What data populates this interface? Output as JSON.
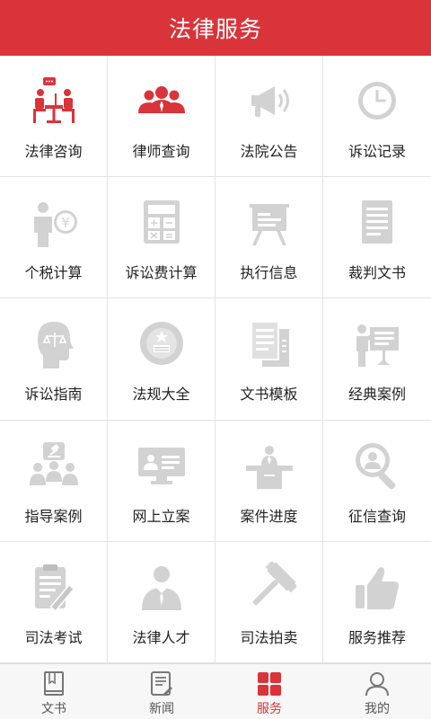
{
  "header": {
    "title": "法律服务"
  },
  "colors": {
    "accent": "#d9343a",
    "icon_gray": "#d2d2d2"
  },
  "services": [
    {
      "label": "法律咨询",
      "icon": "consult-icon",
      "active": true
    },
    {
      "label": "律师查询",
      "icon": "lawyers-icon",
      "active": true
    },
    {
      "label": "法院公告",
      "icon": "megaphone-icon",
      "active": false
    },
    {
      "label": "诉讼记录",
      "icon": "clock-icon",
      "active": false
    },
    {
      "label": "个税计算",
      "icon": "tax-icon",
      "active": false
    },
    {
      "label": "诉讼费计算",
      "icon": "calculator-icon",
      "active": false
    },
    {
      "label": "执行信息",
      "icon": "board-icon",
      "active": false
    },
    {
      "label": "裁判文书",
      "icon": "document-icon",
      "active": false
    },
    {
      "label": "诉讼指南",
      "icon": "scale-head-icon",
      "active": false
    },
    {
      "label": "法规大全",
      "icon": "emblem-icon",
      "active": false
    },
    {
      "label": "文书模板",
      "icon": "template-icon",
      "active": false
    },
    {
      "label": "经典案例",
      "icon": "presentation-icon",
      "active": false
    },
    {
      "label": "指导案例",
      "icon": "gavel-group-icon",
      "active": false
    },
    {
      "label": "网上立案",
      "icon": "id-card-icon",
      "active": false
    },
    {
      "label": "案件进度",
      "icon": "podium-icon",
      "active": false
    },
    {
      "label": "征信查询",
      "icon": "magnifier-person-icon",
      "active": false
    },
    {
      "label": "司法考试",
      "icon": "clipboard-pen-icon",
      "active": false
    },
    {
      "label": "法律人才",
      "icon": "person-suit-icon",
      "active": false
    },
    {
      "label": "司法拍卖",
      "icon": "hammer-icon",
      "active": false
    },
    {
      "label": "服务推荐",
      "icon": "thumbs-up-icon",
      "active": false
    }
  ],
  "tabs": [
    {
      "label": "文书",
      "icon": "book-icon",
      "active": false
    },
    {
      "label": "新闻",
      "icon": "news-icon",
      "active": false
    },
    {
      "label": "服务",
      "icon": "grid-icon",
      "active": true
    },
    {
      "label": "我的",
      "icon": "user-icon",
      "active": false
    }
  ]
}
